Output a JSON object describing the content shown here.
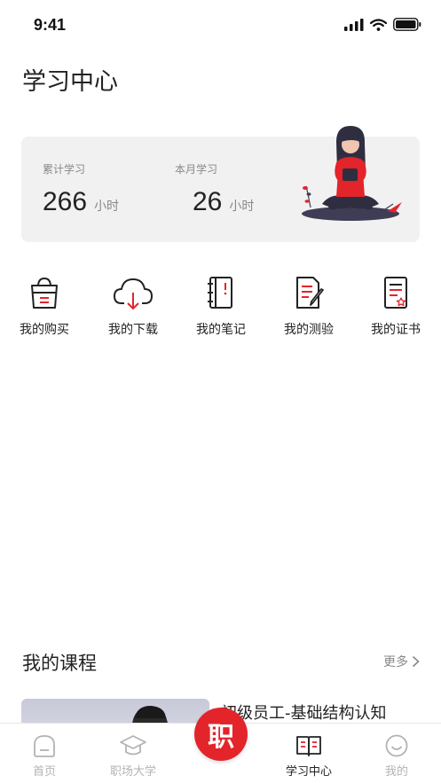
{
  "status_bar": {
    "time": "9:41"
  },
  "page_title": "学习中心",
  "stats": {
    "total": {
      "label": "累计学习",
      "value": "266",
      "unit": "小时"
    },
    "month": {
      "label": "本月学习",
      "value": "26",
      "unit": "小时"
    }
  },
  "quick_actions": [
    {
      "label": "我的购买",
      "icon": "shopping-bag-icon"
    },
    {
      "label": "我的下载",
      "icon": "cloud-download-icon"
    },
    {
      "label": "我的笔记",
      "icon": "notebook-icon"
    },
    {
      "label": "我的测验",
      "icon": "quiz-icon"
    },
    {
      "label": "我的证书",
      "icon": "certificate-icon"
    }
  ],
  "courses": {
    "title": "我的课程",
    "more": "更多",
    "items": [
      {
        "title": "初级员工-基础结构认知"
      }
    ]
  },
  "tab_bar": {
    "items": [
      {
        "label": "首页",
        "icon": "home-icon"
      },
      {
        "label": "职场大学",
        "icon": "graduation-cap-icon"
      },
      {
        "label": "学习中心",
        "icon": "open-book-icon",
        "active": true
      },
      {
        "label": "我的",
        "icon": "smiley-icon"
      }
    ],
    "center_label": "职"
  },
  "colors": {
    "accent": "#e3242b",
    "text": "#222222",
    "muted": "#888888",
    "card": "#f1f1f1"
  }
}
